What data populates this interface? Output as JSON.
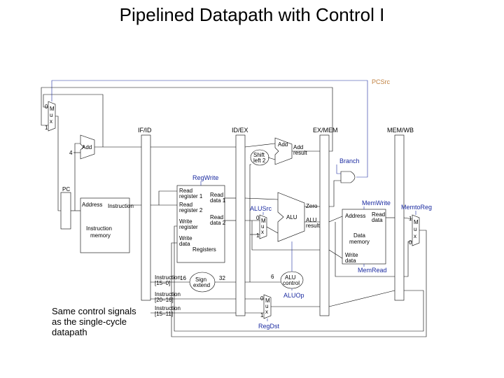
{
  "title": "Pipelined Datapath with Control I",
  "caption": "Same control signals as the single-cycle datapath",
  "regs": {
    "ifid": "IF/ID",
    "idex": "ID/EX",
    "exmem": "EX/MEM",
    "memwb": "MEM/WB"
  },
  "components": {
    "pc": "PC",
    "imem_addr": "Address",
    "imem_name": "Instruction memory",
    "imem_out": "Instruction",
    "add1": "Add",
    "four": "4",
    "mux0": "M\nu\nx",
    "regfile": "Registers",
    "rr1": "Read\nregister 1",
    "rr2": "Read\nregister 2",
    "wr": "Write\nregister",
    "wd": "Write\ndata",
    "rd1": "Read\ndata 1",
    "rd2": "Read\ndata 2",
    "signext": "Sign\nextend",
    "sl2": "Shift\nleft 2",
    "add2": "Add",
    "add2res": "Add\nresult",
    "alu": "ALU",
    "aluzero": "Zero",
    "alures": "ALU\nresult",
    "aluctrl": "ALU\ncontrol",
    "dm_addr": "Address",
    "dm_name": "Data\nmemory",
    "dm_wd": "Write\ndata",
    "dm_rd": "Read\ndata",
    "inst15_0": "Instruction\n[15–0]",
    "inst20_16": "Instruction\n[20–16]",
    "inst15_11": "Instruction\n[15–11]",
    "six": "6",
    "sixteen": "16",
    "thirtytwo": "32"
  },
  "signals": {
    "pcsrc": "PCSrc",
    "regwrite": "RegWrite",
    "alusrc": "ALUSrc",
    "aluop": "ALUOp",
    "regdst": "RegDst",
    "branch": "Branch",
    "memwrite": "MemWrite",
    "memread": "MemRead",
    "memtoreg": "MemtoReg"
  }
}
